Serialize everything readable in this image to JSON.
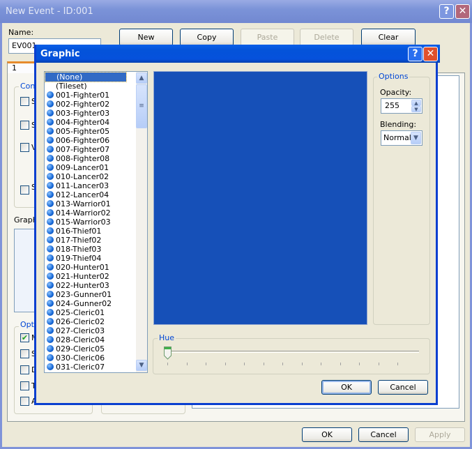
{
  "window": {
    "title": "New Event - ID:001",
    "help": "?",
    "close": "✕"
  },
  "name": {
    "label": "Name:",
    "value": "EV001"
  },
  "toolbar": {
    "new": "New",
    "copy": "Copy",
    "paste": "Paste",
    "delete": "Delete",
    "clear": "Clear"
  },
  "tab": {
    "label": "1"
  },
  "behind": {
    "conditions": "Cond",
    "graphic": "Graph",
    "options": "Opti",
    "cond_letters": [
      "S",
      "S",
      "V",
      "S"
    ],
    "opt_letters": [
      "M",
      "S",
      "D",
      "T",
      "A"
    ],
    "opt_checked": [
      true,
      false,
      false,
      false,
      false
    ]
  },
  "footer": {
    "ok": "OK",
    "cancel": "Cancel",
    "apply": "Apply"
  },
  "dialog": {
    "title": "Graphic",
    "help": "?",
    "close": "✕",
    "items": [
      "(None)",
      "(Tileset)",
      "001-Fighter01",
      "002-Fighter02",
      "003-Fighter03",
      "004-Fighter04",
      "005-Fighter05",
      "006-Fighter06",
      "007-Fighter07",
      "008-Fighter08",
      "009-Lancer01",
      "010-Lancer02",
      "011-Lancer03",
      "012-Lancer04",
      "013-Warrior01",
      "014-Warrior02",
      "015-Warrior03",
      "016-Thief01",
      "017-Thief02",
      "018-Thief03",
      "019-Thief04",
      "020-Hunter01",
      "021-Hunter02",
      "022-Hunter03",
      "023-Gunner01",
      "024-Gunner02",
      "025-Cleric01",
      "026-Cleric02",
      "027-Cleric03",
      "028-Cleric04",
      "029-Cleric05",
      "030-Cleric06",
      "031-Cleric07"
    ],
    "selected": "(None)",
    "preview_color": "#1650b8",
    "options": {
      "title": "Options",
      "opacity_label": "Opacity:",
      "opacity": "255",
      "blending_label": "Blending:",
      "blending": "Normal"
    },
    "hue": {
      "label": "Hue",
      "value": 0
    },
    "ok": "OK",
    "cancel": "Cancel"
  }
}
